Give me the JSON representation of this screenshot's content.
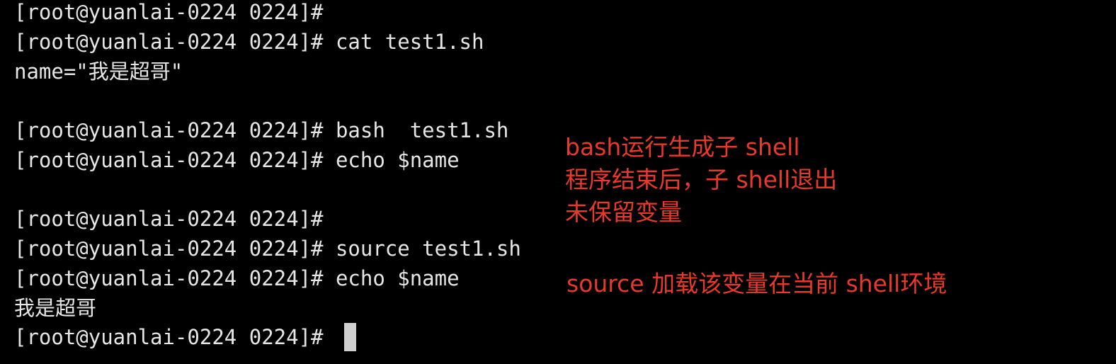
{
  "terminal": {
    "lines": [
      "[root@yuanlai-0224 0224]#",
      "[root@yuanlai-0224 0224]# cat test1.sh",
      "name=\"我是超哥\"",
      "",
      "[root@yuanlai-0224 0224]# bash  test1.sh",
      "[root@yuanlai-0224 0224]# echo $name",
      "",
      "[root@yuanlai-0224 0224]#",
      "[root@yuanlai-0224 0224]# source test1.sh",
      "[root@yuanlai-0224 0224]# echo $name",
      "我是超哥",
      "[root@yuanlai-0224 0224]# "
    ]
  },
  "annotations": {
    "bash": [
      "bash运行生成子 shell",
      "程序结束后，子 shell退出",
      "未保留变量"
    ],
    "source": "source 加载该变量在当前 shell环境"
  },
  "colors": {
    "background": "#000000",
    "text": "#e6e6e6",
    "annotation": "#e8392a",
    "cursor": "#d0d0d0"
  }
}
